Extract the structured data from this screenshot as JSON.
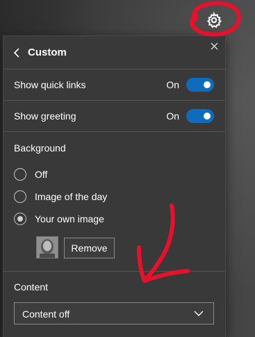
{
  "panel": {
    "title": "Custom",
    "back_icon": "chevron-left-icon",
    "close_icon": "close-icon"
  },
  "toggles": [
    {
      "label": "Show quick links",
      "state": "On",
      "enabled": true
    },
    {
      "label": "Show greeting",
      "state": "On",
      "enabled": true
    }
  ],
  "background": {
    "title": "Background",
    "options": [
      {
        "label": "Off",
        "selected": false
      },
      {
        "label": "Image of the day",
        "selected": false
      },
      {
        "label": "Your own image",
        "selected": true
      }
    ],
    "remove_label": "Remove"
  },
  "content": {
    "title": "Content",
    "selected": "Content off"
  },
  "colors": {
    "toggle_on": "#0f6cbd",
    "panel_bg": "#393939",
    "annotation": "#e8102a"
  },
  "icons": {
    "settings": "gear-icon",
    "dropdown": "chevron-down-icon"
  }
}
